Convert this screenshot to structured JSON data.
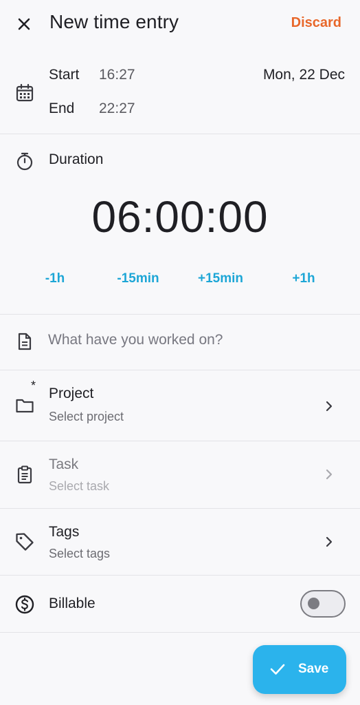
{
  "header": {
    "title": "New time entry",
    "discard_label": "Discard"
  },
  "time_range": {
    "start_label": "Start",
    "start_time": "16:27",
    "end_label": "End",
    "end_time": "22:27",
    "date": "Mon, 22 Dec"
  },
  "duration": {
    "label": "Duration",
    "value": "06:00:00",
    "adjustments": [
      "-1h",
      "-15min",
      "+15min",
      "+1h"
    ]
  },
  "description": {
    "placeholder": "What have you worked on?",
    "value": ""
  },
  "project": {
    "required_marker": "*",
    "title": "Project",
    "subtitle": "Select project"
  },
  "task": {
    "title": "Task",
    "subtitle": "Select task",
    "enabled": false
  },
  "tags": {
    "title": "Tags",
    "subtitle": "Select tags"
  },
  "billable": {
    "label": "Billable",
    "on": false
  },
  "save": {
    "label": "Save"
  },
  "colors": {
    "accent": "#2bb3ec",
    "link": "#1da6d6",
    "discard": "#e8672a",
    "background": "#f8f8fa"
  },
  "icons": [
    "close-icon",
    "calendar-icon",
    "timer-icon",
    "document-icon",
    "folder-icon",
    "clipboard-icon",
    "tag-icon",
    "dollar-icon",
    "chevron-right-icon",
    "check-icon"
  ]
}
